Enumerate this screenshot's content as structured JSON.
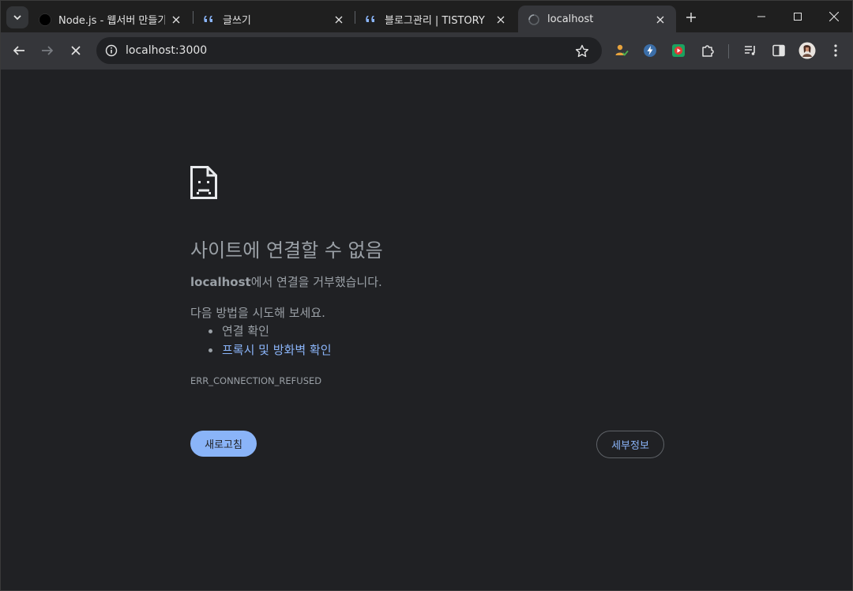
{
  "tabs": [
    {
      "title": "Node.js - 웹서버 만들기",
      "icon": "black-circle-icon"
    },
    {
      "title": "글쓰기",
      "icon": "tistory-quote-icon"
    },
    {
      "title": "블로그관리 | TISTORY",
      "icon": "tistory-quote-icon"
    },
    {
      "title": "localhost",
      "icon": "loading-spinner-icon",
      "active": true
    }
  ],
  "omnibox": {
    "url": "localhost:3000"
  },
  "error_page": {
    "headline": "사이트에 연결할 수 없음",
    "host": "localhost",
    "message_suffix": "에서 연결을 거부했습니다.",
    "try_label": "다음 방법을 시도해 보세요.",
    "suggestions": [
      "연결 확인",
      "프록시 및 방화벽 확인"
    ],
    "error_code": "ERR_CONNECTION_REFUSED",
    "reload_label": "새로고침",
    "details_label": "세부정보"
  },
  "colors": {
    "accent": "#8ab4f8",
    "background": "#202124",
    "text": "#9aa0a6"
  }
}
